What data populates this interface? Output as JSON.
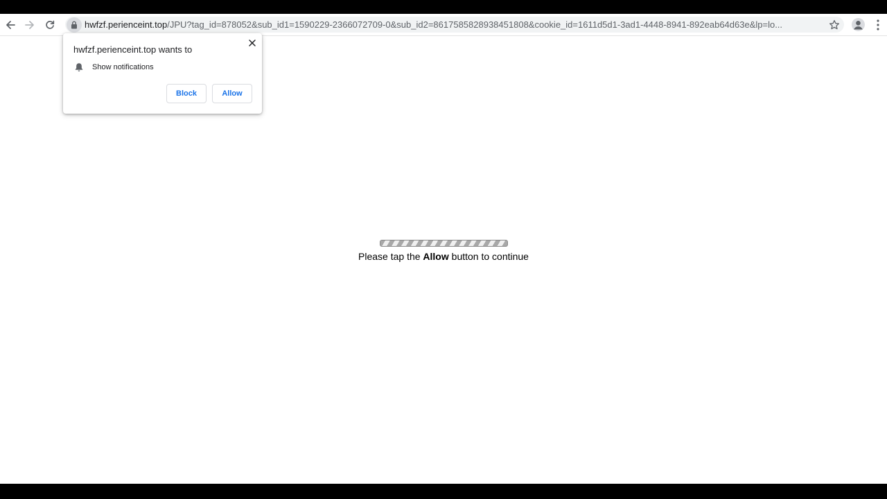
{
  "browser": {
    "url_host": "hwfzf.perienceint.top",
    "url_rest": "/JPU?tag_id=878052&sub_id1=1590229-2366072709-0&sub_id2=8617585828938451808&cookie_id=1611d5d1-3ad1-4448-8941-892eab64d63e&lp=lo...",
    "icons": {
      "back": "arrow-left-icon",
      "forward": "arrow-right-icon",
      "reload": "reload-icon",
      "lock": "lock-icon",
      "bookmark": "star-icon",
      "profile": "avatar-icon",
      "menu": "kebab-menu-icon"
    }
  },
  "permission_popup": {
    "title": "hwfzf.perienceint.top wants to",
    "permission": "Show notifications",
    "block_label": "Block",
    "allow_label": "Allow",
    "icons": {
      "close": "close-icon",
      "bell": "bell-icon"
    }
  },
  "page": {
    "instruction_prefix": "Please tap the ",
    "instruction_bold": "Allow",
    "instruction_suffix": " button to continue"
  },
  "colors": {
    "button_text": "#1a73e8",
    "omnibox_bg": "#f1f3f4"
  }
}
